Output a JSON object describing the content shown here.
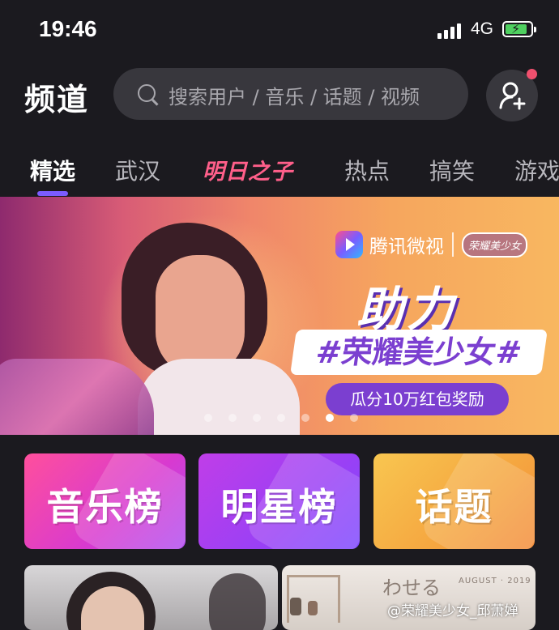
{
  "status_bar": {
    "time": "19:46",
    "network": "4G"
  },
  "header": {
    "title": "频道",
    "search_placeholder": "搜索用户 / 音乐 / 话题 / 视频"
  },
  "tabs": [
    {
      "label": "精选",
      "active": true
    },
    {
      "label": "武汉",
      "active": false
    },
    {
      "label": "明日之子",
      "active": false
    },
    {
      "label": "热点",
      "active": false
    },
    {
      "label": "搞笑",
      "active": false
    },
    {
      "label": "游戏",
      "active": false
    }
  ],
  "banner": {
    "brand": "腾讯微视",
    "partner_logo": "荣耀美少女",
    "headline": "助力",
    "hashtag": "#荣耀美少女#",
    "subline": "瓜分10万红包奖励",
    "carousel_total": 7,
    "carousel_active_index": 5
  },
  "feature_cards": [
    {
      "label": "音乐榜"
    },
    {
      "label": "明星榜"
    },
    {
      "label": "话题"
    }
  ],
  "thumbnails": [
    {
      "text": ""
    },
    {
      "text": "わせる",
      "date": "AUGUST · 2019"
    }
  ],
  "watermark": "@荣耀美少女_邱萧婵",
  "colors": {
    "accent": "#7b5cff",
    "badge": "#f0506e",
    "background": "#1b1a1f"
  }
}
